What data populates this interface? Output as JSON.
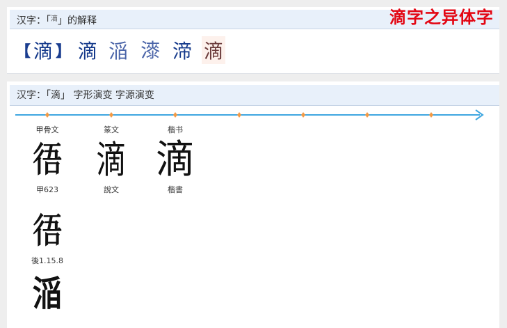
{
  "panel1": {
    "header_prefix": "汉字：「",
    "header_char": "滴",
    "header_suffix": "」的解释",
    "variant_title": "滴字之异体字",
    "bracket_open": "【",
    "main_char": "滴",
    "bracket_close": "】",
    "variants": [
      "滴",
      "㴞",
      "𣾰",
      "渧",
      "滴"
    ]
  },
  "panel2": {
    "header": "汉字：「滴」 字形演变 字源演变",
    "timeline_ticks": 7,
    "stages": [
      {
        "label": "甲骨文",
        "glyph": "𢓲",
        "caption": "甲623"
      },
      {
        "label": "篆文",
        "glyph": "滴",
        "caption": "說文"
      },
      {
        "label": "楷书",
        "glyph": "滴",
        "caption": "楷書"
      }
    ],
    "extra": [
      {
        "glyph": "𢓲",
        "caption": "後1.15.8"
      },
      {
        "glyph": "㴞"
      }
    ]
  },
  "colors": {
    "header_bg": "#e8f0fa",
    "variant_title": "#e30613",
    "variant_char": "#13388a",
    "timeline": "#3ea6e0",
    "timeline_tick": "#f39a45"
  }
}
